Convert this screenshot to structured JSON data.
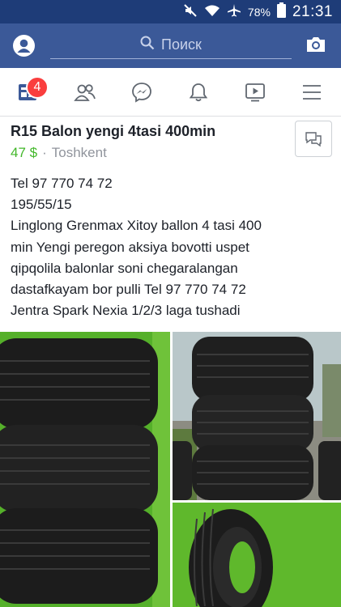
{
  "status_bar": {
    "battery_percent": "78%",
    "time": "21:31",
    "icons": [
      "mute-icon",
      "wifi-icon",
      "airplane-icon",
      "battery-icon"
    ]
  },
  "header": {
    "search_placeholder": "Поиск",
    "icons": [
      "profile-icon",
      "search-icon",
      "camera-icon"
    ]
  },
  "nav": {
    "badge_count": "4",
    "items": [
      "news-feed",
      "friends",
      "messenger",
      "notifications",
      "watch",
      "menu"
    ]
  },
  "post": {
    "title": "R15 Balon yengi 4tasi 400min",
    "price": "47 $",
    "separator": "·",
    "location": "Toshkent",
    "body_lines": [
      "Tel 97 770 74 72",
      "195/55/15",
      "Linglong Grenmax Xitoy ballon 4 tasi 400",
      "min Yengi peregon aksiya bovotti uspet",
      "qipqolila balonlar soni chegaralangan",
      "dastafkayam bor pulli Tel 97 770 74 72",
      "Jentra Spark Nexia 1/2/3 laga tushadi"
    ]
  },
  "colors": {
    "status_bar": "#1e3c78",
    "header": "#3b5998",
    "price": "#42b72a",
    "badge": "#fa3e3e",
    "muted_text": "#90949c"
  }
}
